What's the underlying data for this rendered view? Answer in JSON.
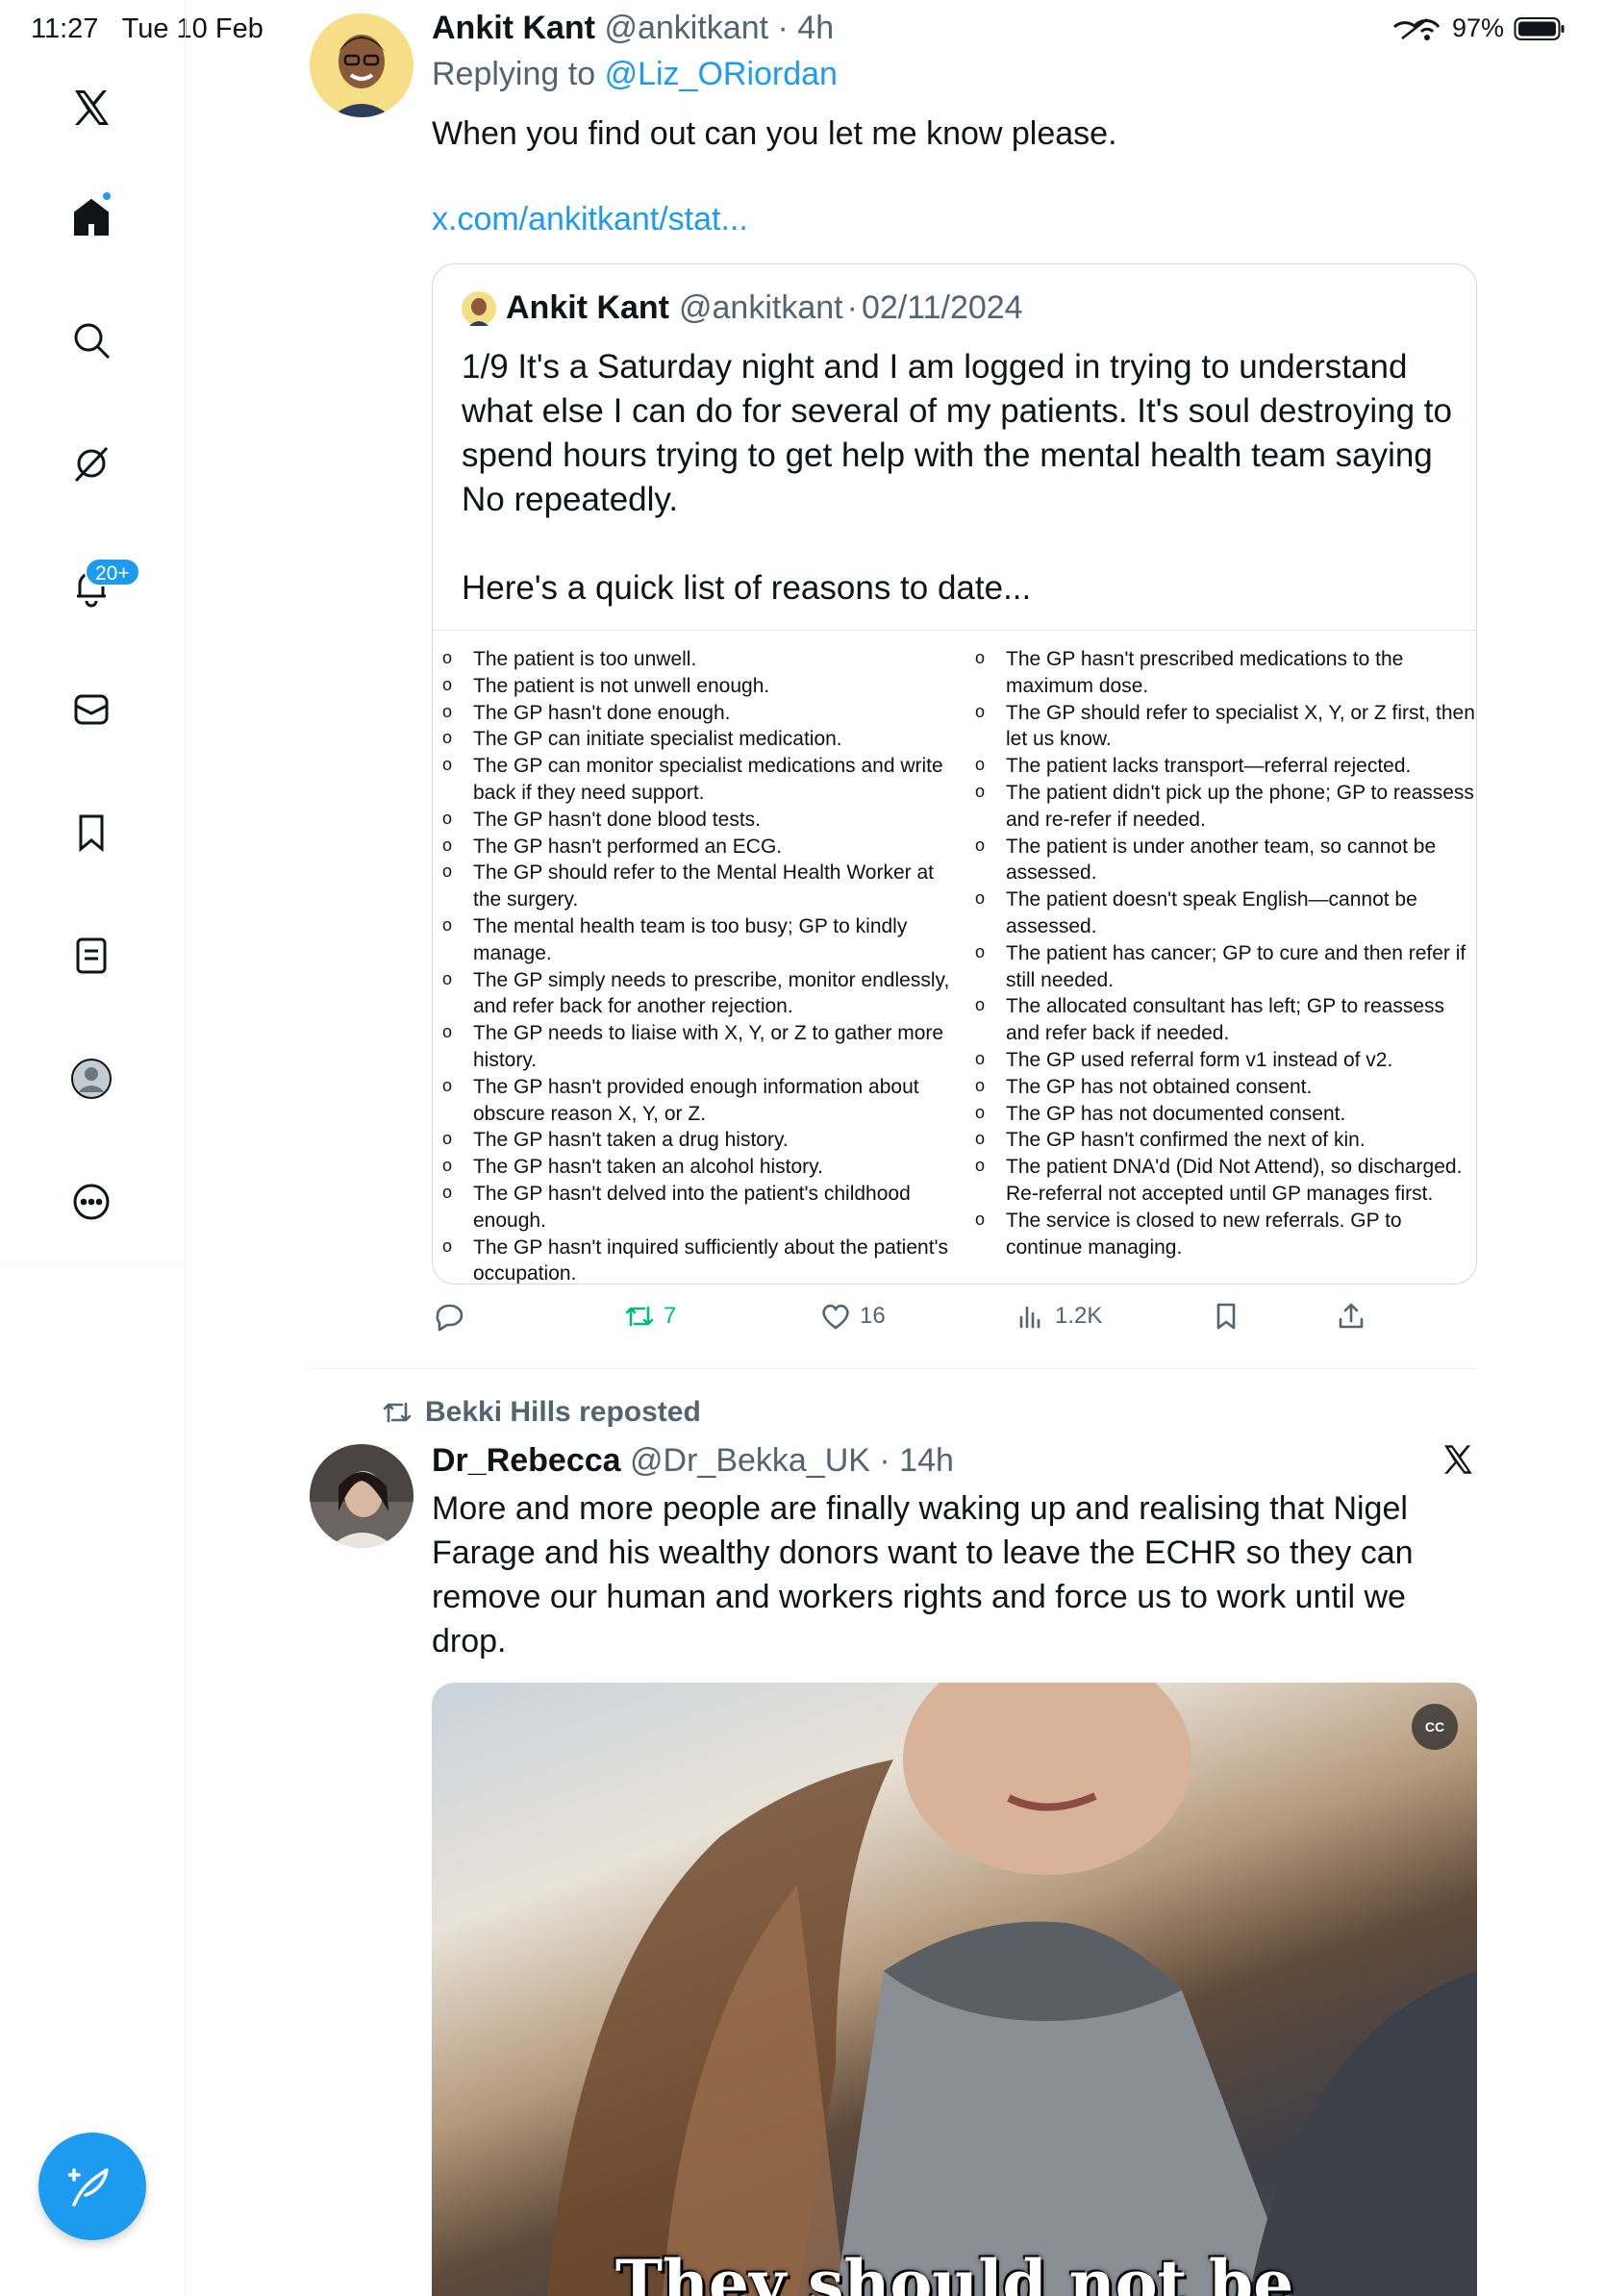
{
  "status_bar": {
    "time": "11:27",
    "date": "Tue 10 Feb",
    "battery": "97%"
  },
  "sidebar": {
    "notifications_badge": "20+",
    "icons": [
      "x-logo-icon",
      "home-icon",
      "search-icon",
      "grok-icon",
      "bell-icon",
      "messages-icon",
      "bookmark-icon",
      "lists-icon",
      "profile-icon",
      "more-icon"
    ],
    "compose": "compose-icon"
  },
  "tweet1": {
    "author": "Ankit Kant",
    "handle": "@ankitkant",
    "time": "4h",
    "replying_prefix": "Replying to",
    "replying_to": "@Liz_ORiordan",
    "text": "When you find out can you let me know please.",
    "link": "x.com/ankitkant/stat...",
    "quote": {
      "author": "Ankit Kant",
      "handle": "@ankitkant",
      "date": "02/11/2024",
      "text_p1": "1/9 It's a Saturday night and I am logged in trying to understand what else I can do for several of my patients. It's soul destroying to spend hours trying to get help with the mental health team saying No repeatedly.",
      "text_p2": "Here's a quick list of reasons to date...",
      "list_left": [
        "The patient is too unwell.",
        "The patient is not unwell enough.",
        "The GP hasn't done enough.",
        "The GP can initiate specialist medication.",
        "The GP can monitor specialist medications and write back if they need support.",
        "The GP hasn't done blood tests.",
        "The GP hasn't performed an ECG.",
        "The GP should refer to the Mental Health Worker at the surgery.",
        "The mental health team is too busy; GP to kindly manage.",
        "The GP simply needs to prescribe, monitor endlessly, and refer back for another rejection.",
        "The GP needs to liaise with X, Y, or Z to gather more history.",
        "The GP hasn't provided enough information about obscure reason X, Y, or Z.",
        "The GP hasn't taken a drug history.",
        "The GP hasn't taken an alcohol history.",
        "The GP hasn't delved into the patient's childhood enough.",
        "The GP hasn't inquired sufficiently about the patient's occupation."
      ],
      "list_right": [
        "The GP hasn't prescribed medications to the maximum dose.",
        "The GP should refer to specialist X, Y, or Z first, then let us know.",
        "The patient lacks transport—referral rejected.",
        "The patient didn't pick up the phone; GP to reassess and re-refer if needed.",
        "The patient is under another team, so cannot be assessed.",
        "The patient doesn't speak English—cannot be assessed.",
        "The patient has cancer; GP to cure and then refer if still needed.",
        "The allocated consultant has left; GP to reassess and refer back if needed.",
        "The GP used referral form v1 instead of v2.",
        "The GP has not obtained consent.",
        "The GP has not documented consent.",
        "The GP hasn't confirmed the next of kin.",
        "The patient DNA'd (Did Not Attend), so discharged. Re-referral not accepted until GP manages first.",
        "The service is closed to new referrals. GP to continue managing."
      ]
    },
    "actions": {
      "reposts": "7",
      "likes": "16",
      "views": "1.2K"
    },
    "colors": {
      "retweeted": "#00ba7c",
      "link": "#1d9bf0"
    }
  },
  "tweet2": {
    "reposted_by": "Bekki Hills reposted",
    "author": "Dr_Rebecca",
    "handle": "@Dr_Bekka_UK",
    "time": "14h",
    "text": "More and more people are finally waking up and realising that Nigel Farage and his wealthy donors want to leave the ECHR so they can remove our human and workers rights and force us to work until we drop.",
    "video_caption": "They should not be",
    "cc_label": "CC"
  }
}
